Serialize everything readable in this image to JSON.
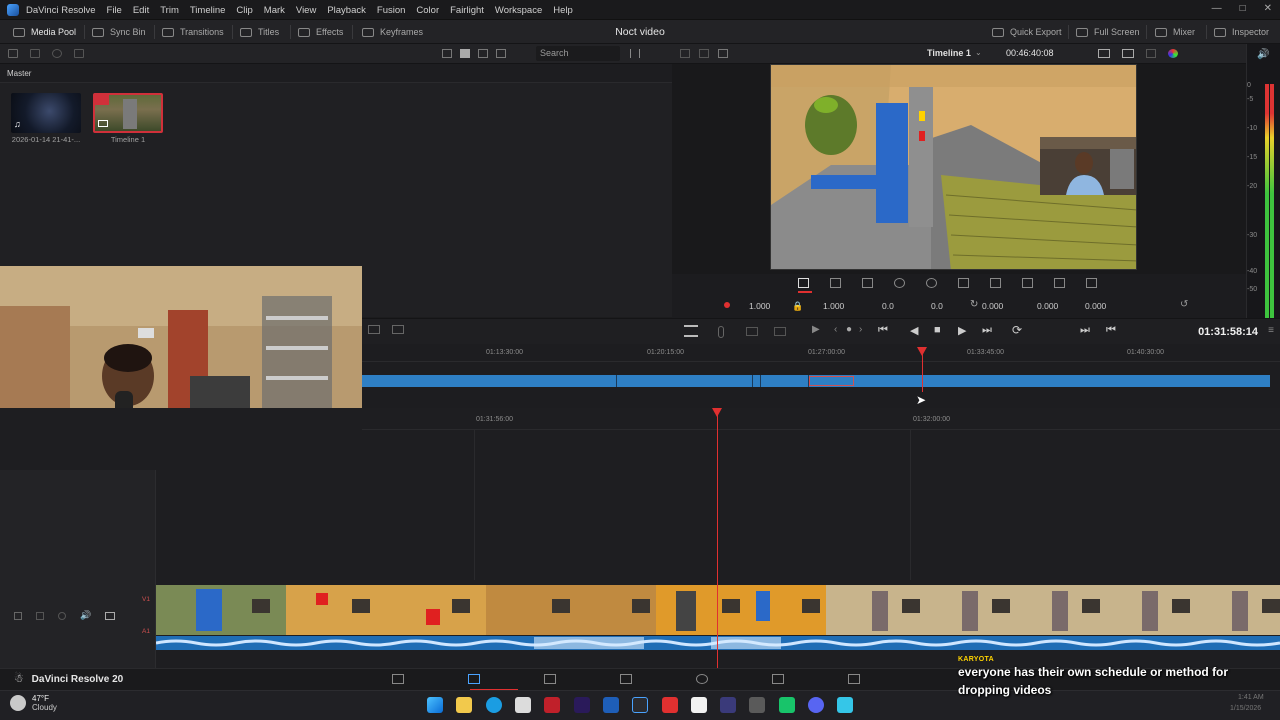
{
  "app": {
    "menu": [
      "DaVinci Resolve",
      "File",
      "Edit",
      "Trim",
      "Timeline",
      "Clip",
      "Mark",
      "View",
      "Playback",
      "Fusion",
      "Color",
      "Fairlight",
      "Workspace",
      "Help"
    ],
    "project_title": "Noct video",
    "name": "DaVinci Resolve 20"
  },
  "toolbar": {
    "media_pool": "Media Pool",
    "sync_bin": "Sync Bin",
    "transitions": "Transitions",
    "titles": "Titles",
    "effects": "Effects",
    "keyframes": "Keyframes",
    "quick_export": "Quick Export",
    "full_screen": "Full Screen",
    "mixer": "Mixer",
    "inspector": "Inspector"
  },
  "media_pool": {
    "search_placeholder": "Search",
    "bin_name": "Master",
    "clips": [
      {
        "label": "2026-01-14 21-41-..."
      },
      {
        "label": "Timeline 1"
      }
    ]
  },
  "viewer": {
    "timeline_name": "Timeline 1",
    "timecode": "00:46:40:08",
    "transform": {
      "zoom_x": "1.000",
      "zoom_y": "1.000",
      "pos_x": "0.0",
      "pos_y": "0.0",
      "rotation": "0.000",
      "pitch": "0.000",
      "yaw": "0.000"
    }
  },
  "transport": {
    "timecode": "01:31:58:14"
  },
  "upper_timeline": {
    "ticks": [
      "01:13:30:00",
      "01:20:15:00",
      "01:27:00:00",
      "01:33:45:00",
      "01:40:30:00"
    ]
  },
  "lower_timeline": {
    "ticks": [
      "01:31:56:00",
      "01:32:00:00"
    ],
    "tracks": [
      "V1",
      "A1"
    ]
  },
  "meter": {
    "scale": [
      "0",
      "-5",
      "-10",
      "-15",
      "-20",
      "-30",
      "-40",
      "-50"
    ]
  },
  "caption": {
    "brand": "KARYOTA",
    "text": "everyone has their own schedule or method for dropping videos"
  },
  "taskbar": {
    "weather_temp": "47°F",
    "weather_desc": "Cloudy",
    "time": "1:41 AM",
    "date": "1/15/2026"
  },
  "colors": {
    "accent_blue": "#2e7fc4",
    "playhead_red": "#e03030",
    "caption_yellow": "#ffd400"
  }
}
